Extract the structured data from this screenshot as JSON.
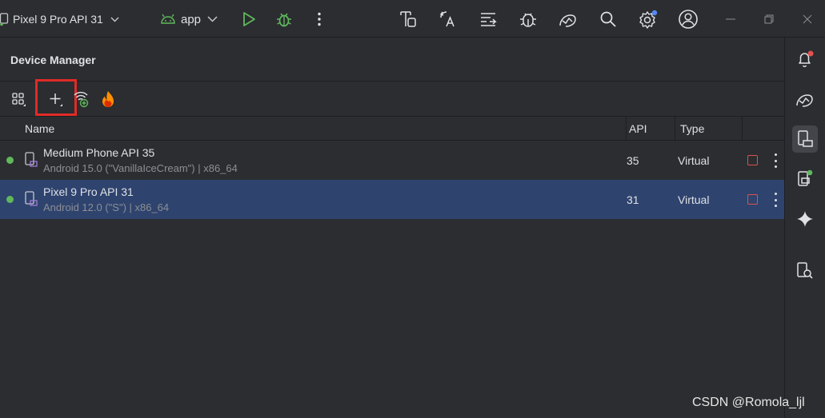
{
  "topbar": {
    "device_selector": "Pixel 9 Pro API 31",
    "app_selector": "app",
    "icons": [
      "run-icon",
      "debug-icon",
      "more-icon",
      "layout-inspector-icon",
      "translate-icon",
      "logcat-icon",
      "debug-bug-icon",
      "app-quality-icon",
      "search-icon",
      "settings-icon",
      "account-icon",
      "minimize-icon",
      "restore-icon",
      "close-icon"
    ]
  },
  "panel": {
    "title": "Device Manager",
    "toolbar_icons": [
      "device-group-icon",
      "add-device-icon",
      "pair-wifi-icon",
      "firebase-icon"
    ]
  },
  "table": {
    "columns": [
      "Name",
      "API",
      "Type"
    ],
    "rows": [
      {
        "name": "Medium Phone API 35",
        "description": "Android 15.0 (\"VanillaIceCream\") | x86_64",
        "api": "35",
        "type": "Virtual",
        "status": "running",
        "selected": false
      },
      {
        "name": "Pixel 9 Pro API 31",
        "description": "Android 12.0 (\"S\") | x86_64",
        "api": "31",
        "type": "Virtual",
        "status": "running",
        "selected": true
      }
    ]
  },
  "right_strip": {
    "icons": [
      "notifications-icon",
      "app-quality-icon",
      "device-manager-icon",
      "running-devices-icon",
      "gemini-icon",
      "device-explorer-icon"
    ]
  },
  "colors": {
    "background": "#2b2d30",
    "selected_row": "#2e436e",
    "status_green": "#5fb85c",
    "stop_red": "#d9534f",
    "highlight_red": "#e02b27",
    "accent_blue": "#548af7"
  },
  "watermark": "CSDN @Romola_ljl"
}
